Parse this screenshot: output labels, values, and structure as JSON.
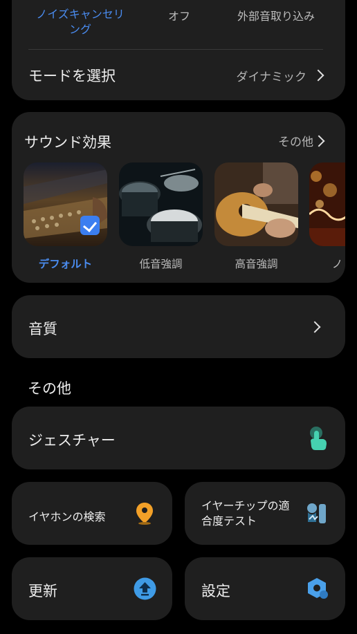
{
  "anc": {
    "modes": [
      "ノイズキャンセリング",
      "オフ",
      "外部音取り込み"
    ],
    "mode_row_label": "モードを選択",
    "mode_row_value": "ダイナミック"
  },
  "sound_effects": {
    "title": "サウンド効果",
    "more": "その他",
    "items": [
      "デフォルト",
      "低音強調",
      "高音強調",
      "ノ"
    ]
  },
  "sound_quality": {
    "label": "音質"
  },
  "other_section": {
    "title": "その他"
  },
  "tiles": {
    "gesture": "ジェスチャー",
    "find": "イヤホンの検索",
    "fit_test": "イヤーチップの適合度テスト",
    "update": "更新",
    "settings": "設定"
  },
  "colors": {
    "accent": "#4a8cf0",
    "card": "#1f1f1f",
    "find_icon": "#f2a028",
    "update_icon": "#3f9be6",
    "settings_icon": "#4aa0ea",
    "gesture_icon": "#3fc9a8"
  }
}
